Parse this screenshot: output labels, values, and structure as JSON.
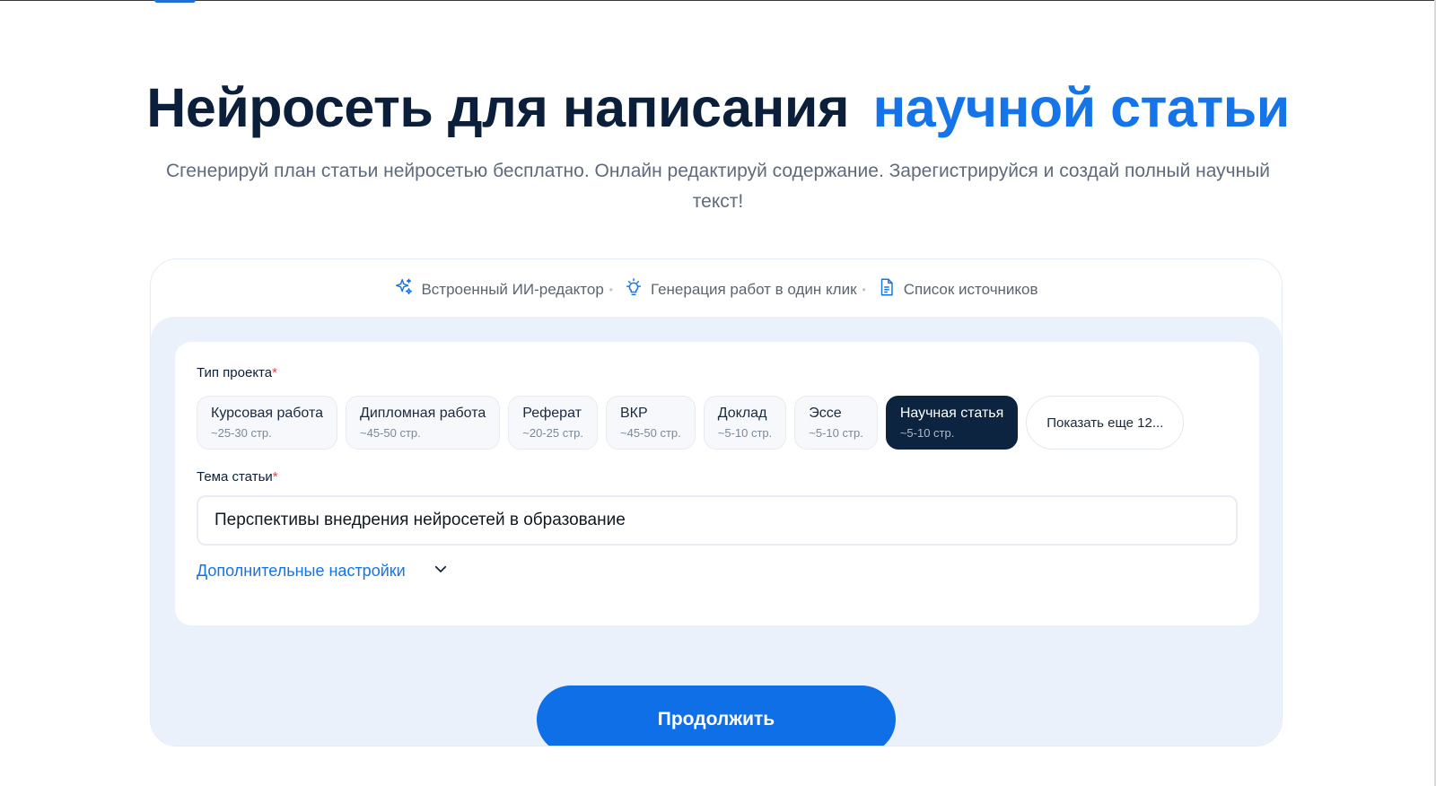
{
  "hero": {
    "title_dark": "Нейросеть для написания",
    "title_accent": "научной статьи",
    "subtitle": "Сгенерируй план статьи нейросетью бесплатно. Онлайн редактируй содержание. Зарегистрируйся и создай полный научный текст!"
  },
  "features": [
    {
      "label": "Встроенный ИИ-редактор",
      "icon": "sparkles-icon"
    },
    {
      "label": "Генерация работ в один клик",
      "icon": "lightbulb-icon"
    },
    {
      "label": "Список источников",
      "icon": "document-icon"
    }
  ],
  "form": {
    "project_type_label": "Тип проекта",
    "required_mark": "*",
    "project_types": [
      {
        "name": "Курсовая работа",
        "pages": "~25-30 стр."
      },
      {
        "name": "Дипломная работа",
        "pages": "~45-50 стр."
      },
      {
        "name": "Реферат",
        "pages": "~20-25 стр."
      },
      {
        "name": "ВКР",
        "pages": "~45-50 стр."
      },
      {
        "name": "Доклад",
        "pages": "~5-10 стр."
      },
      {
        "name": "Эссе",
        "pages": "~5-10 стр."
      },
      {
        "name": "Научная статья",
        "pages": "~5-10 стр.",
        "selected": true
      }
    ],
    "show_more_label": "Показать еще 12...",
    "topic_label": "Тема статьи",
    "topic_value": "Перспективы внедрения нейросетей в образование",
    "advanced_settings_label": "Дополнительные настройки",
    "continue_label": "Продолжить"
  },
  "colors": {
    "accent": "#1474e8",
    "dark": "#0b1f3a",
    "selected_chip": "#0c2440",
    "panel_bg": "#eaf1fa",
    "button": "#0f6fe6"
  }
}
